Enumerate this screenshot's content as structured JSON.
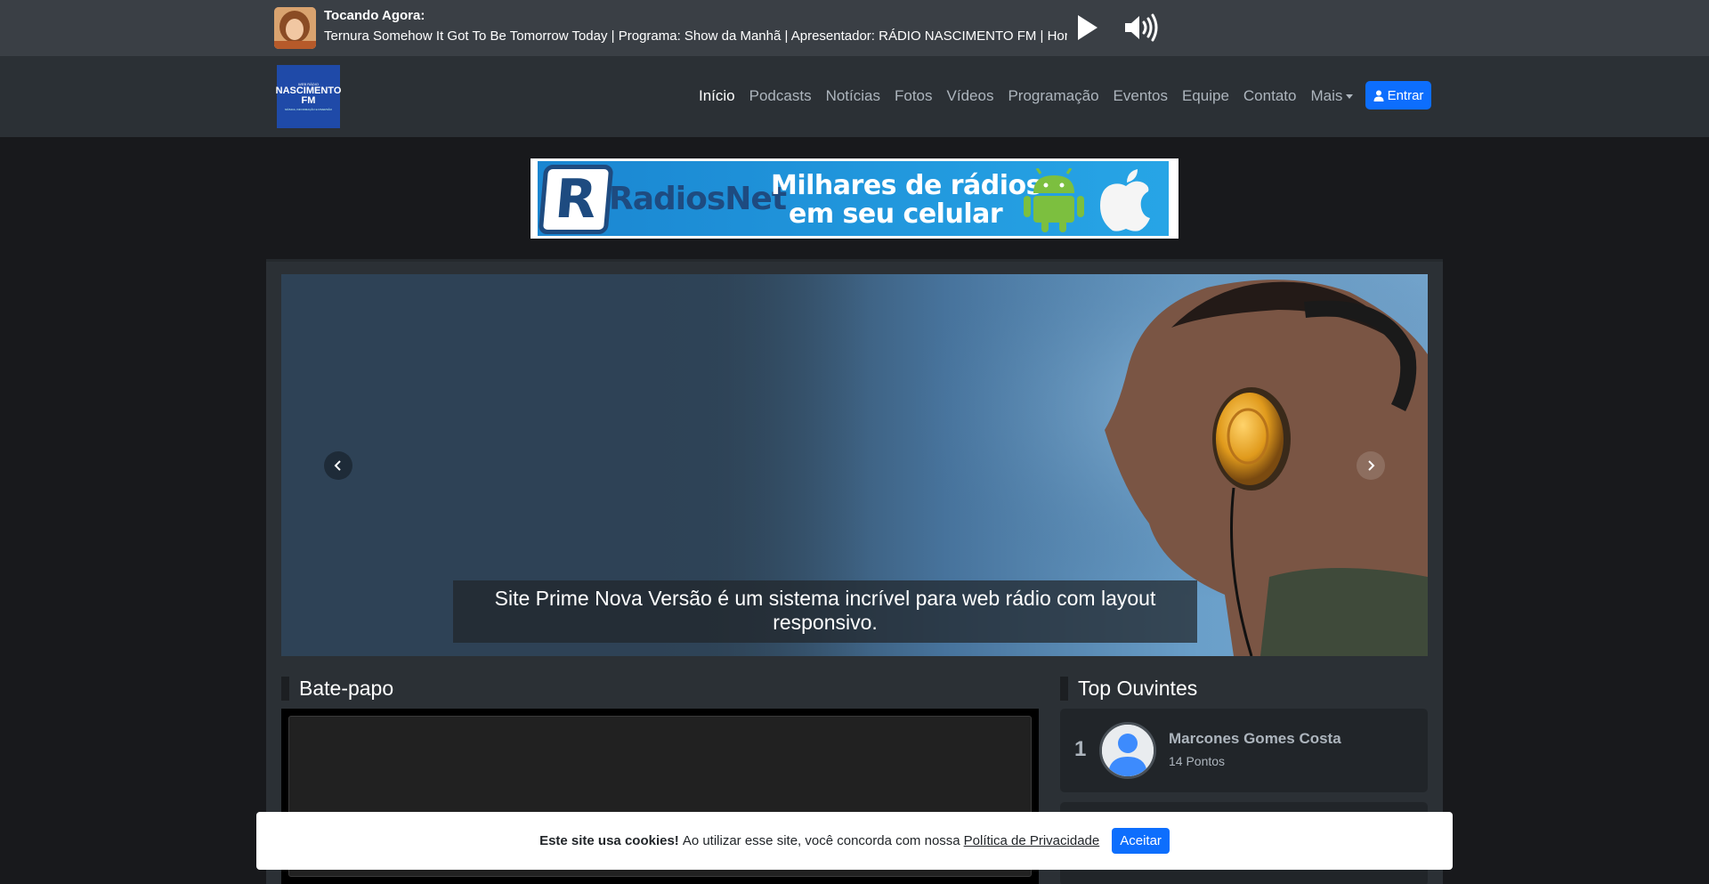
{
  "player": {
    "now_playing_label": "Tocando Agora:",
    "track_text": "Ternura Somehow It Got To Be Tomorrow Today | Programa: Show da Manhã | Apresentador: RÁDIO NASCIMENTO FM | Horár"
  },
  "navbar": {
    "logo": {
      "top": "WEB RÁDIO",
      "name_line1": "NASCIMENTO",
      "name_line2": "FM",
      "tagline": "MÚSICA, INFORMAÇÃO E DIVERSÃO"
    },
    "links": [
      {
        "label": "Início",
        "active": true
      },
      {
        "label": "Podcasts",
        "active": false
      },
      {
        "label": "Notícias",
        "active": false
      },
      {
        "label": "Fotos",
        "active": false
      },
      {
        "label": "Vídeos",
        "active": false
      },
      {
        "label": "Programação",
        "active": false
      },
      {
        "label": "Eventos",
        "active": false
      },
      {
        "label": "Equipe",
        "active": false
      },
      {
        "label": "Contato",
        "active": false
      },
      {
        "label": "Mais",
        "active": false
      }
    ],
    "login_label": "Entrar",
    "accent": "#0d6efd"
  },
  "ad": {
    "logo_letter": "R",
    "brand": "RadiosNet",
    "line1": "Milhares de rádios",
    "line2": "em seu celular"
  },
  "carousel": {
    "caption": "Site Prime Nova Versão é um sistema incrível para web rádio com layout responsivo."
  },
  "chat": {
    "title": "Bate-papo"
  },
  "top_listeners": {
    "title": "Top Ouvintes",
    "items": [
      {
        "rank": "1",
        "name": "Marcones Gomes Costa",
        "points": "14 Pontos"
      }
    ]
  },
  "cookie": {
    "bold": "Este site usa cookies!",
    "text": "Ao utilizar esse site, você concorda com nossa",
    "link": "Política de Privacidade",
    "accept": "Aceitar"
  }
}
